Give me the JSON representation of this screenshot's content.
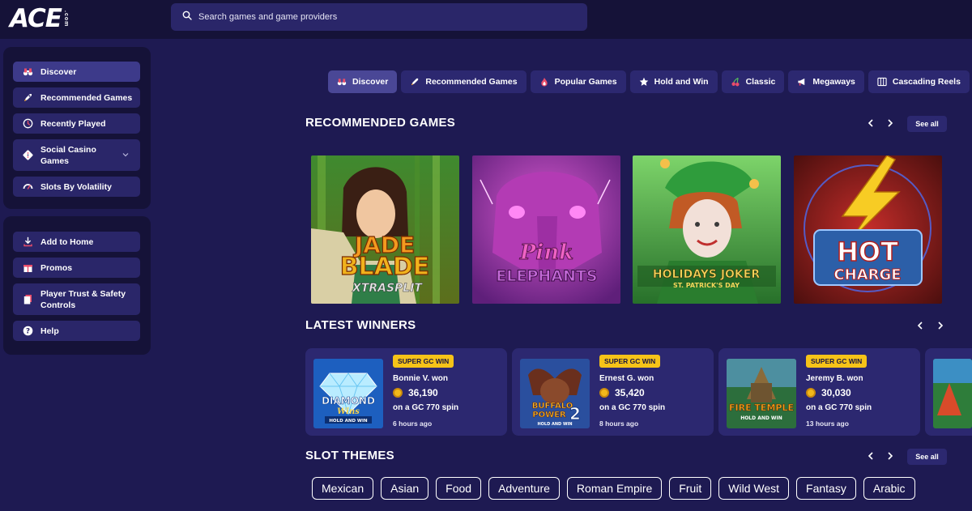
{
  "header": {
    "logo_text": "ACE",
    "logo_suffix": ".com",
    "search_placeholder": "Search games and game providers"
  },
  "sidebar": {
    "primary": [
      {
        "label": "Discover",
        "icon": "binoculars-icon"
      },
      {
        "label": "Recommended Games",
        "icon": "rocket-icon"
      },
      {
        "label": "Recently Played",
        "icon": "clock-icon"
      },
      {
        "label": "Social Casino Games",
        "icon": "dice-icon"
      },
      {
        "label": "Slots By Volatility",
        "icon": "gauge-icon"
      }
    ],
    "secondary": [
      {
        "label": "Add to Home",
        "icon": "download-icon"
      },
      {
        "label": "Promos",
        "icon": "gift-icon"
      },
      {
        "label": "Player Trust & Safety Controls",
        "icon": "documents-icon"
      },
      {
        "label": "Help",
        "icon": "help-icon"
      }
    ]
  },
  "tabs": [
    {
      "label": "Discover",
      "icon": "binoculars-icon"
    },
    {
      "label": "Recommended Games",
      "icon": "rocket-icon"
    },
    {
      "label": "Popular Games",
      "icon": "flame-icon"
    },
    {
      "label": "Hold and Win",
      "icon": "star-icon"
    },
    {
      "label": "Classic",
      "icon": "cherry-icon"
    },
    {
      "label": "Megaways",
      "icon": "megaphone-icon"
    },
    {
      "label": "Cascading Reels",
      "icon": "reels-icon"
    }
  ],
  "recommended": {
    "title": "RECOMMENDED GAMES",
    "see_all": "See all",
    "games": [
      {
        "title_line1": "JADE",
        "title_line2": "BLADE",
        "title_line3": "XTRASPLIT"
      },
      {
        "title_line1": "Pink",
        "title_line2": "ELEPHANTS"
      },
      {
        "title_line1": "HOLIDAYS JOKER",
        "title_line2": "ST. PATRICK'S DAY"
      },
      {
        "title_line1": "HOT",
        "title_line2": "CHARGE"
      }
    ]
  },
  "winners": {
    "title": "LATEST WINNERS",
    "items": [
      {
        "badge": "SUPER GC WIN",
        "who": "Bonnie V. won",
        "amount": "36,190",
        "spin": "on a GC 770 spin",
        "time": "6 hours ago",
        "game_line1": "DIAMOND",
        "game_line2": "Wins",
        "game_line3": "HOLD AND WIN"
      },
      {
        "badge": "SUPER GC WIN",
        "who": "Ernest G. won",
        "amount": "35,420",
        "spin": "on a GC 770 spin",
        "time": "8 hours ago",
        "game_line1": "BUFFALO",
        "game_line2": "POWER",
        "game_line3": "2",
        "game_line4": "HOLD AND WIN"
      },
      {
        "badge": "SUPER GC WIN",
        "who": "Jeremy B. won",
        "amount": "30,030",
        "spin": "on a GC 770 spin",
        "time": "13 hours ago",
        "game_line1": "FIRE TEMPLE",
        "game_line2": "HOLD AND WIN"
      }
    ]
  },
  "themes": {
    "title": "SLOT THEMES",
    "see_all": "See all",
    "chips": [
      "Mexican",
      "Asian",
      "Food",
      "Adventure",
      "Roman Empire",
      "Fruit",
      "Wild West",
      "Fantasy",
      "Arabic"
    ]
  },
  "colors": {
    "background": "#1e1a52",
    "panel": "#151238",
    "item": "#2a2669",
    "active": "#3d3a8a",
    "badge": "#f6c318"
  }
}
